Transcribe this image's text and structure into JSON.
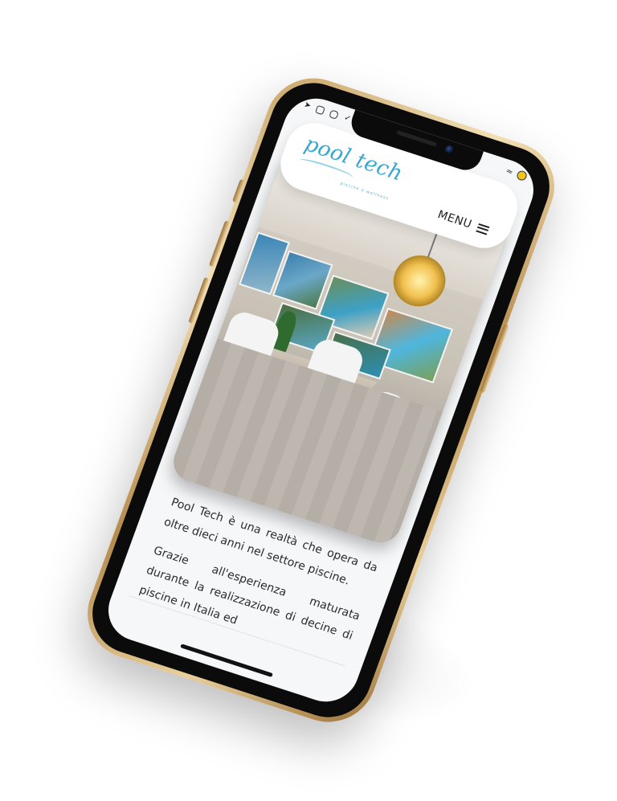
{
  "status_bar": {
    "left_icons": [
      "send-icon",
      "mail-icon",
      "instagram-icon",
      "twitter-icon"
    ],
    "right_icons": [
      "wifi-icon",
      "battery-icon"
    ]
  },
  "header": {
    "logo_text": "pool tech",
    "logo_tagline": "piscine e wellness",
    "menu_label": "MENU"
  },
  "photo": {
    "alt": "showroom-interior"
  },
  "content": {
    "paragraph_1": "Pool Tech è una realtà che opera da oltre dieci anni nel settore piscine.",
    "paragraph_2": "Grazie all'esperienza maturata durante la realizzazione di decine di piscine in Italia ed"
  },
  "colors": {
    "brand": "#35a7d0",
    "text": "#2b2b2b",
    "frame_gold": "#caa76b"
  }
}
